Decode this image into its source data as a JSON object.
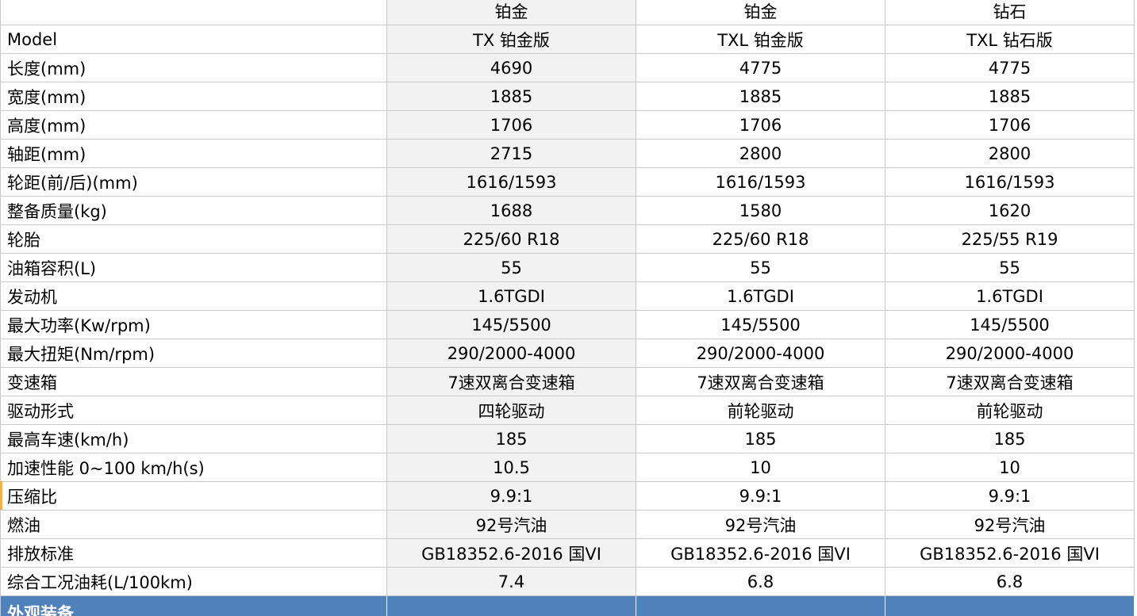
{
  "sheet": {
    "header": {
      "label": "",
      "cols": [
        "铂金",
        "铂金",
        "钻石"
      ]
    },
    "rows": [
      {
        "label": "Model",
        "values": [
          "TX 铂金版",
          "TXL 铂金版",
          "TXL 钻石版"
        ]
      },
      {
        "label": "长度(mm)",
        "values": [
          "4690",
          "4775",
          "4775"
        ]
      },
      {
        "label": "宽度(mm)",
        "values": [
          "1885",
          "1885",
          "1885"
        ]
      },
      {
        "label": "高度(mm)",
        "values": [
          "1706",
          "1706",
          "1706"
        ]
      },
      {
        "label": "轴距(mm)",
        "values": [
          "2715",
          "2800",
          "2800"
        ]
      },
      {
        "label": "轮距(前/后)(mm)",
        "values": [
          "1616/1593",
          "1616/1593",
          "1616/1593"
        ]
      },
      {
        "label": "整备质量(kg)",
        "values": [
          "1688",
          "1580",
          "1620"
        ]
      },
      {
        "label": "轮胎",
        "values": [
          "225/60 R18",
          "225/60 R18",
          "225/55 R19"
        ]
      },
      {
        "label": "油箱容积(L)",
        "values": [
          "55",
          "55",
          "55"
        ]
      },
      {
        "label": "发动机",
        "values": [
          "1.6TGDI",
          "1.6TGDI",
          "1.6TGDI"
        ]
      },
      {
        "label": "最大功率(Kw/rpm)",
        "values": [
          "145/5500",
          "145/5500",
          "145/5500"
        ]
      },
      {
        "label": "最大扭矩(Nm/rpm)",
        "values": [
          "290/2000-4000",
          "290/2000-4000",
          "290/2000-4000"
        ]
      },
      {
        "label": "变速箱",
        "values": [
          "7速双离合变速箱",
          "7速双离合变速箱",
          "7速双离合变速箱"
        ]
      },
      {
        "label": "驱动形式",
        "values": [
          "四轮驱动",
          "前轮驱动",
          "前轮驱动"
        ]
      },
      {
        "label": "最高车速(km/h)",
        "values": [
          "185",
          "185",
          "185"
        ]
      },
      {
        "label": "加速性能 0~100 km/h(s)",
        "values": [
          "10.5",
          "10",
          "10"
        ]
      },
      {
        "label": "压缩比",
        "values": [
          "9.9:1",
          "9.9:1",
          "9.9:1"
        ]
      },
      {
        "label": "燃油",
        "values": [
          "92号汽油",
          "92号汽油",
          "92号汽油"
        ]
      },
      {
        "label": "排放标准",
        "values": [
          "GB18352.6-2016 国VI",
          "GB18352.6-2016 国VI",
          "GB18352.6-2016 国VI"
        ]
      },
      {
        "label": "综合工况油耗(L/100km)",
        "values": [
          "7.4",
          "6.8",
          "6.8"
        ]
      }
    ],
    "section": {
      "label": "外观装备"
    }
  },
  "colors": {
    "grid": "#c8c8c8",
    "shaded_column": "#f2f2f2",
    "section_header": "#4f81bd",
    "section_text": "#ffffff",
    "row_marker": "#f5b041"
  }
}
